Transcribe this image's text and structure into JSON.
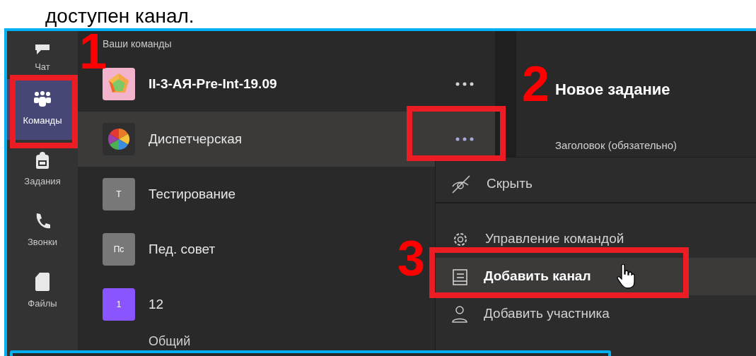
{
  "page_heading": "доступен канал.",
  "rail": [
    {
      "label": "Чат",
      "selected": false
    },
    {
      "label": "Команды",
      "selected": true
    },
    {
      "label": "Задания",
      "selected": false
    },
    {
      "label": "Звонки",
      "selected": false
    },
    {
      "label": "Файлы",
      "selected": false
    }
  ],
  "teams_header": "Ваши команды",
  "teams": [
    {
      "name": "II-3-АЯ-Pre-Int-19.09",
      "avatar": {
        "kind": "polyhedron"
      },
      "bold": true,
      "hovered": false,
      "more": true
    },
    {
      "name": "Диспетчерская",
      "avatar": {
        "kind": "pie"
      },
      "bold": false,
      "hovered": true,
      "more": true
    },
    {
      "name": "Тестирование",
      "avatar": {
        "kind": "initials",
        "initials": "Т",
        "color": "#787878"
      },
      "bold": false,
      "hovered": false
    },
    {
      "name": "Пед. совет",
      "avatar": {
        "kind": "initials",
        "initials": "Пс",
        "color": "#787878"
      },
      "bold": false,
      "hovered": false
    },
    {
      "name": "12",
      "avatar": {
        "kind": "initials",
        "initials": "1",
        "color": "#8a55ff"
      },
      "bold": false,
      "hovered": false
    }
  ],
  "channel_below": "Общий",
  "task_panel": {
    "title": "Новое задание",
    "field_label": "Заголовок (обязательно)"
  },
  "menu": [
    {
      "label": "Скрыть",
      "hovered": false,
      "divider_after": true
    },
    {
      "label": "Управление командой",
      "hovered": false,
      "divider_after": false
    },
    {
      "label": "Добавить канал",
      "hovered": true,
      "divider_after": false
    },
    {
      "label": "Добавить участника",
      "hovered": false,
      "divider_after": false
    }
  ],
  "annotations": [
    {
      "label": "1"
    },
    {
      "label": "2"
    },
    {
      "label": "3"
    }
  ]
}
